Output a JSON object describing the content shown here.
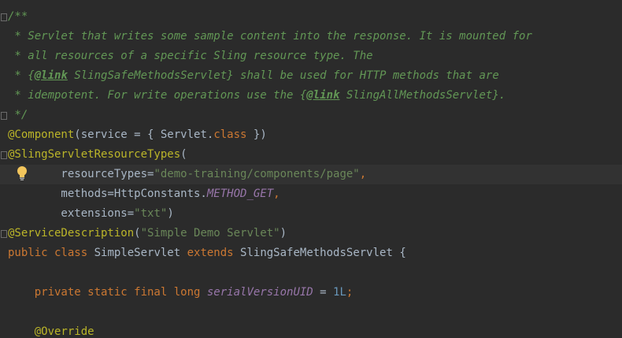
{
  "lines": [
    [
      {
        "c": "comment",
        "t": "/**"
      }
    ],
    [
      {
        "c": "comment",
        "t": " * Servlet that writes some sample content into the response. It is mounted for"
      }
    ],
    [
      {
        "c": "comment",
        "t": " * all resources of a specific Sling resource type. The"
      }
    ],
    [
      {
        "c": "comment",
        "t": " * {"
      },
      {
        "c": "doctag",
        "t": "@link"
      },
      {
        "c": "comment",
        "t": " SlingSafeMethodsServlet} shall be used for HTTP methods that are"
      }
    ],
    [
      {
        "c": "comment",
        "t": " * idempotent. For write operations use the {"
      },
      {
        "c": "doctag",
        "t": "@link"
      },
      {
        "c": "comment",
        "t": " SlingAllMethodsServlet}."
      }
    ],
    [
      {
        "c": "comment",
        "t": " */"
      }
    ],
    [
      {
        "c": "annotation",
        "t": "@Component"
      },
      {
        "c": "plain",
        "t": "(service = { Servlet."
      },
      {
        "c": "keyword",
        "t": "class"
      },
      {
        "c": "plain",
        "t": " })"
      }
    ],
    [
      {
        "c": "annotation",
        "t": "@SlingServletResourceTypes"
      },
      {
        "c": "plain",
        "t": "("
      }
    ],
    [
      {
        "c": "plain",
        "t": "        resourceTypes="
      },
      {
        "c": "string",
        "t": "\"demo-training/components/page\""
      },
      {
        "c": "punct",
        "t": ","
      }
    ],
    [
      {
        "c": "plain",
        "t": "        methods=HttpConstants."
      },
      {
        "c": "constant",
        "t": "METHOD_GET"
      },
      {
        "c": "punct",
        "t": ","
      }
    ],
    [
      {
        "c": "plain",
        "t": "        extensions="
      },
      {
        "c": "string",
        "t": "\"txt\""
      },
      {
        "c": "plain",
        "t": ")"
      }
    ],
    [
      {
        "c": "annotation",
        "t": "@ServiceDescription"
      },
      {
        "c": "plain",
        "t": "("
      },
      {
        "c": "string",
        "t": "\"Simple Demo Servlet\""
      },
      {
        "c": "plain",
        "t": ")"
      }
    ],
    [
      {
        "c": "keyword",
        "t": "public class"
      },
      {
        "c": "plain",
        "t": " SimpleServlet "
      },
      {
        "c": "keyword",
        "t": "extends"
      },
      {
        "c": "plain",
        "t": " SlingSafeMethodsServlet {"
      }
    ],
    [],
    [
      {
        "c": "keyword",
        "t": "    private static final long"
      },
      {
        "c": "plain",
        "t": " "
      },
      {
        "c": "constant",
        "t": "serialVersionUID"
      },
      {
        "c": "plain",
        "t": " = "
      },
      {
        "c": "number",
        "t": "1L"
      },
      {
        "c": "punct",
        "t": ";"
      }
    ],
    [],
    [
      {
        "c": "annotation",
        "t": "    @Override"
      }
    ]
  ],
  "highlight_line": 8,
  "icons": {
    "intention": "lightbulb-icon",
    "fold": "fold-marker-icon"
  },
  "colors": {
    "background": "#2b2b2b",
    "comment": "#629755",
    "annotation": "#bbb529",
    "keyword": "#cc7832",
    "string": "#6a8759",
    "constant": "#9876aa",
    "number": "#6897bb",
    "text": "#a9b7c6"
  }
}
